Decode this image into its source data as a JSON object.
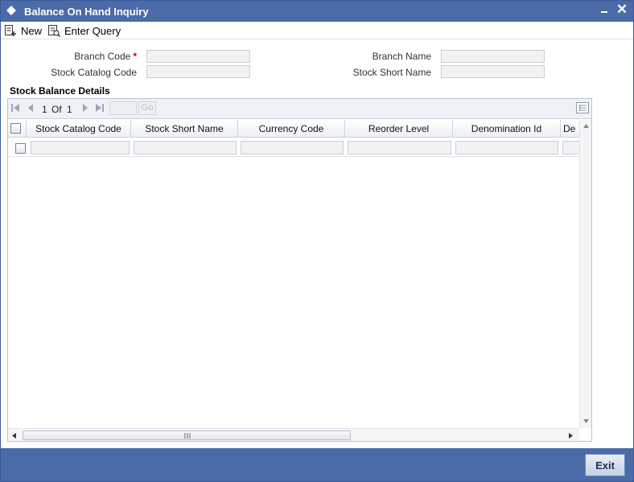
{
  "window": {
    "title": "Balance On Hand Inquiry",
    "minimize_icon": "minimize-icon",
    "close_icon": "close-icon",
    "close_glyph": "✕"
  },
  "toolbar": {
    "new_label": "New",
    "enter_query_label": "Enter Query"
  },
  "form": {
    "branch_code_label": "Branch Code",
    "branch_code_required": "*",
    "branch_code_value": "",
    "stock_catalog_code_label": "Stock Catalog Code",
    "stock_catalog_code_value": "",
    "branch_name_label": "Branch Name",
    "branch_name_value": "",
    "stock_short_name_label": "Stock Short Name",
    "stock_short_name_value": ""
  },
  "stock_balance": {
    "section_title": "Stock Balance Details",
    "pager": {
      "current_page": "1",
      "of_label": "Of",
      "total_pages": "1",
      "go_label": "Go",
      "page_input_value": ""
    },
    "columns": [
      "Stock Catalog Code",
      "Stock Short Name",
      "Currency Code",
      "Reorder Level",
      "Denomination Id",
      "De"
    ],
    "rows": [
      {
        "stock_catalog_code": "",
        "stock_short_name": "",
        "currency_code": "",
        "reorder_level": "",
        "denomination_id": "",
        "de": ""
      }
    ]
  },
  "footer": {
    "exit_label": "Exit"
  },
  "colors": {
    "titlebar": "#4a6aa8",
    "footer": "#4a6aa8",
    "required": "#cc0000",
    "field_bg": "#f2f2f2"
  }
}
